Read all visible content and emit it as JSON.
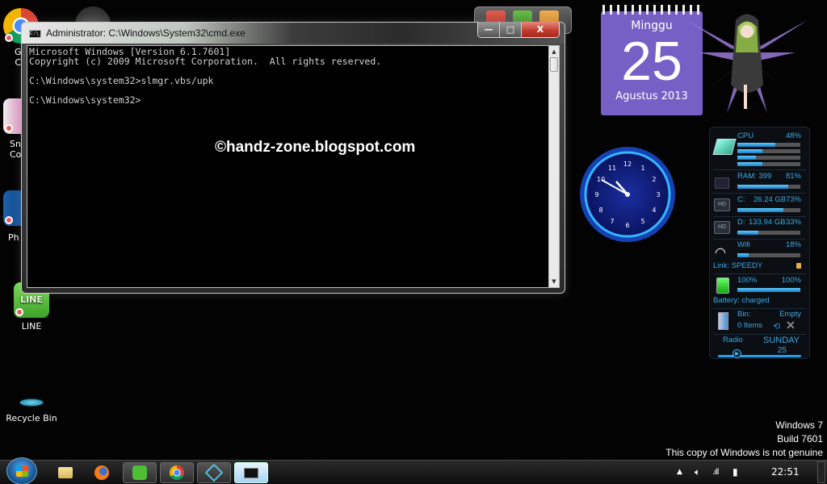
{
  "desktop": {
    "icons": [
      {
        "label": "G\nC",
        "name": "google-chrome"
      },
      {
        "label": "Sn\nCo",
        "name": "snipping-tool"
      },
      {
        "label": "Ph",
        "name": "photoshop"
      },
      {
        "label": "LINE",
        "name": "line"
      },
      {
        "label": "Recycle Bin",
        "name": "recycle-bin"
      }
    ],
    "watermark": "©handz-zone.blogspot.com",
    "genuine_notice": [
      "Windows 7",
      "Build 7601",
      "This copy of Windows is not genuine"
    ]
  },
  "cmd_window": {
    "title": "Administrator: C:\\Windows\\System32\\cmd.exe",
    "icon_text": "C:\\_",
    "lines": [
      "Microsoft Windows [Version 6.1.7601]",
      "Copyright (c) 2009 Microsoft Corporation.  All rights reserved.",
      "",
      "C:\\Windows\\system32>slmgr.vbs/upk",
      "",
      "C:\\Windows\\system32>"
    ],
    "buttons": {
      "minimize": "—",
      "maximize": "□",
      "close": "X"
    }
  },
  "gadgets": {
    "calendar": {
      "day_name": "Minggu",
      "day": "25",
      "month_year": "Agustus 2013",
      "color": "#7760c5"
    },
    "clock": {
      "time": "22:51",
      "numbers": [
        "12",
        "1",
        "2",
        "3",
        "4",
        "5",
        "6",
        "7",
        "8",
        "9",
        "10",
        "11"
      ]
    },
    "system_monitor": {
      "cpu": {
        "label": "CPU",
        "value": "48%",
        "cores": [
          0.6,
          0.4,
          0.3,
          0.4
        ]
      },
      "ram": {
        "label": "RAM: 399",
        "value": "81%",
        "fill": 0.81
      },
      "drive_c": {
        "label": "C:",
        "size": "26.24 GB",
        "value": "73%",
        "fill": 0.73
      },
      "drive_d": {
        "label": "D:",
        "size": "133.94 GB",
        "value": "33%",
        "fill": 0.33
      },
      "wifi": {
        "label": "Wifi",
        "value": "18%",
        "fill": 0.18,
        "link": "Link: SPEEDY"
      },
      "battery": {
        "left": "100%",
        "right": "100%",
        "fill": 1.0,
        "status": "Battery: charged"
      },
      "bin": {
        "label": "Bin:",
        "items": "0 Items",
        "state": "Empty"
      },
      "radio": {
        "label": "Radio",
        "day": "SUNDAY",
        "date": "25"
      }
    }
  },
  "taskbar": {
    "items": [
      "start",
      "explorer",
      "firefox",
      "line",
      "chrome",
      "snipping",
      "cmd"
    ],
    "clock": "22:51"
  }
}
